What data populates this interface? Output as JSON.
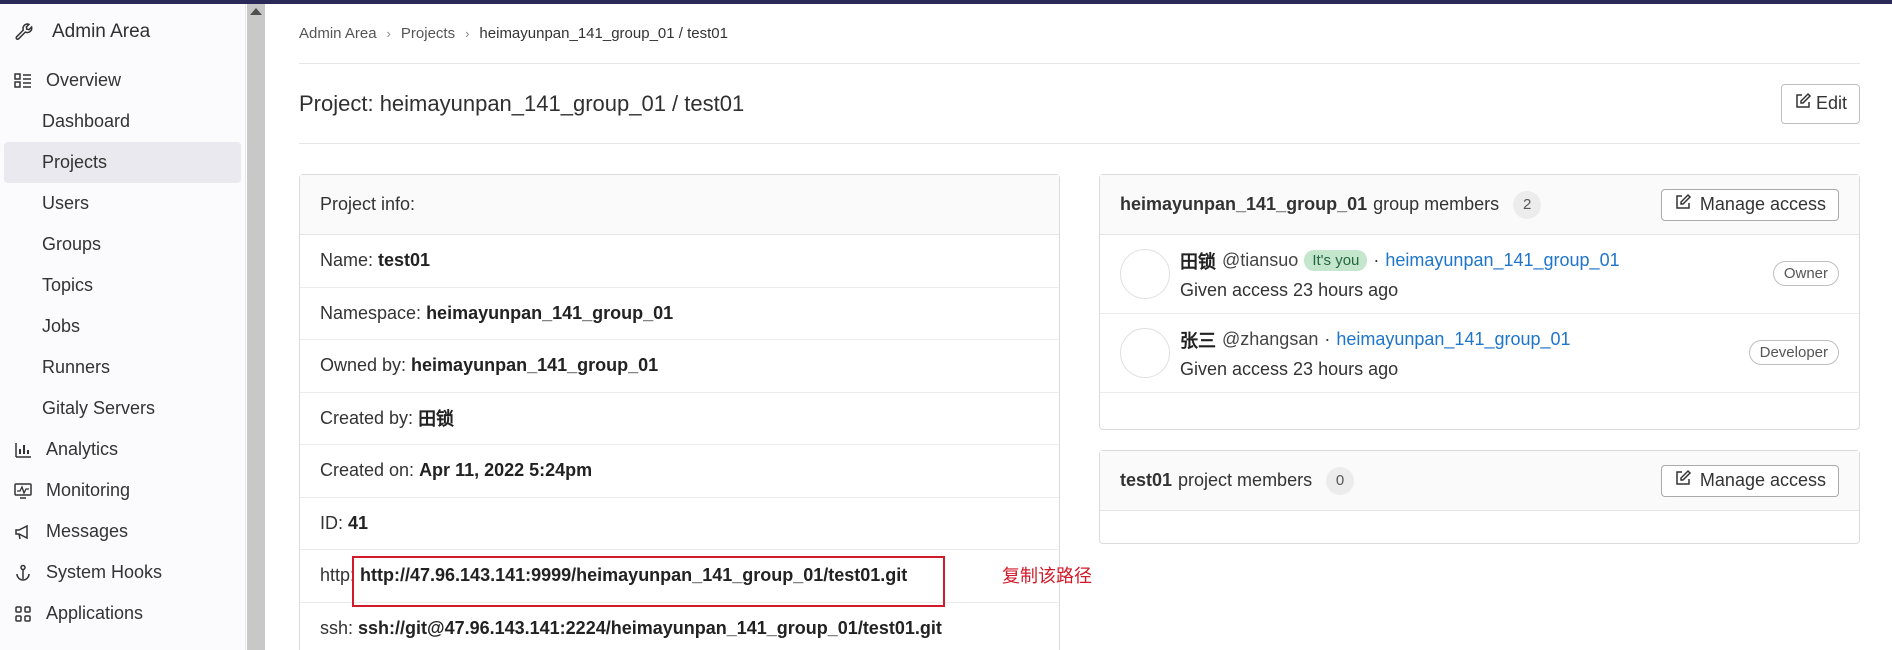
{
  "sidebar": {
    "title": "Admin Area",
    "items": [
      {
        "label": "Overview",
        "icon": "overview-icon",
        "level": "top"
      },
      {
        "label": "Dashboard",
        "level": "sub"
      },
      {
        "label": "Projects",
        "level": "sub",
        "active": true
      },
      {
        "label": "Users",
        "level": "sub"
      },
      {
        "label": "Groups",
        "level": "sub"
      },
      {
        "label": "Topics",
        "level": "sub"
      },
      {
        "label": "Jobs",
        "level": "sub"
      },
      {
        "label": "Runners",
        "level": "sub"
      },
      {
        "label": "Gitaly Servers",
        "level": "sub"
      },
      {
        "label": "Analytics",
        "icon": "analytics-icon",
        "level": "top"
      },
      {
        "label": "Monitoring",
        "icon": "monitoring-icon",
        "level": "top"
      },
      {
        "label": "Messages",
        "icon": "messages-icon",
        "level": "top"
      },
      {
        "label": "System Hooks",
        "icon": "hook-icon",
        "level": "top"
      },
      {
        "label": "Applications",
        "icon": "applications-icon",
        "level": "top"
      }
    ]
  },
  "breadcrumb": [
    "Admin Area",
    "Projects",
    "heimayunpan_141_group_01 / test01"
  ],
  "page": {
    "title": "Project: heimayunpan_141_group_01 / test01",
    "edit_label": "Edit"
  },
  "project_info": {
    "header": "Project info:",
    "rows": [
      {
        "label": "Name:",
        "value": "test01"
      },
      {
        "label": "Namespace:",
        "value": "heimayunpan_141_group_01"
      },
      {
        "label": "Owned by:",
        "value": "heimayunpan_141_group_01"
      },
      {
        "label": "Created by:",
        "value": "田锁"
      },
      {
        "label": "Created on:",
        "value": "Apr 11, 2022 5:24pm"
      },
      {
        "label": "ID:",
        "value": "41"
      },
      {
        "label": "http:",
        "value": "http://47.96.143.141:9999/heimayunpan_141_group_01/test01.git"
      },
      {
        "label": "ssh:",
        "value": "ssh://git@47.96.143.141:2224/heimayunpan_141_group_01/test01.git"
      }
    ]
  },
  "annotation": "复制该路径",
  "group_members": {
    "group_name": "heimayunpan_141_group_01",
    "suffix": "group members",
    "count": "2",
    "manage_label": "Manage access",
    "members": [
      {
        "name": "田锁",
        "username": "@tiansuo",
        "badge": "It's you",
        "sep": "·",
        "group": "heimayunpan_141_group_01",
        "access": "Given access 23 hours ago",
        "role": "Owner"
      },
      {
        "name": "张三",
        "username": "@zhangsan",
        "badge": "",
        "sep": "·",
        "group": "heimayunpan_141_group_01",
        "access": "Given access 23 hours ago",
        "role": "Developer"
      }
    ]
  },
  "project_members": {
    "project_name": "test01",
    "suffix": "project members",
    "count": "0",
    "manage_label": "Manage access"
  },
  "colors": {
    "topbar": "#2a2a59",
    "link": "#1f75cb",
    "highlight": "#d11a2a",
    "its_you_bg": "#c3e6cd"
  }
}
